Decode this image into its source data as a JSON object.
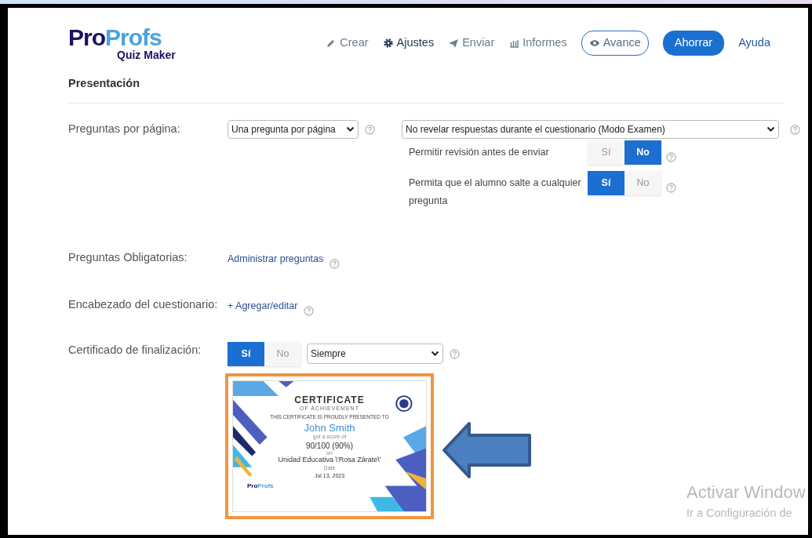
{
  "header": {
    "logo": {
      "part_1": "Pro",
      "part_2": "Profs",
      "subtitle": "Quiz Maker"
    },
    "nav": [
      {
        "label": "Crear",
        "kind": "link",
        "selected": false
      },
      {
        "label": "Ajustes",
        "kind": "link",
        "selected": true
      },
      {
        "label": "Enviar",
        "kind": "link",
        "selected": false
      },
      {
        "label": "Informes",
        "kind": "link",
        "selected": false
      },
      {
        "label": "Avance",
        "kind": "outline"
      },
      {
        "label": "Ahorrar",
        "kind": "primary"
      },
      {
        "label": "Ayuda",
        "kind": "plain"
      }
    ]
  },
  "section_title": "Presentación",
  "questions_per_page": {
    "label": "Preguntas por página:",
    "select": "Una pregunta por página",
    "answers_select": "No revelar respuestas durante el cuestionario (Modo Examen)",
    "options": [
      {
        "label": "Permitir revisión antes de enviar",
        "yes": "Sí",
        "no": "No",
        "on": false
      },
      {
        "label": "Permita que el alumno salte a cualquier pregunta",
        "yes": "Sí",
        "no": "No",
        "on": true
      }
    ]
  },
  "mandatory": {
    "label": "Preguntas Obligatorias:",
    "link": "Administrar preguntas"
  },
  "header_setting": {
    "label": "Encabezado del cuestionario:",
    "link": "+ Agregar/editar"
  },
  "certificate": {
    "label": "Certificado de finalización:",
    "yes": "Sí",
    "no": "No",
    "on": true,
    "select": "Siempre",
    "preview": {
      "title": "CERTIFICATE",
      "subtitle": "OF ACHIEVEMENT",
      "presented": "THIS CERTIFICATE IS PROUDLY PRESENTED TO",
      "name": "John Smith",
      "score_label": "got a score of",
      "score": "90/100 (90%)",
      "on_label": "on",
      "quiz": "Unidad Educativa \\'Rosa Zárate\\'",
      "date_label": "Date",
      "date": "Jul 13, 2023",
      "logo_1": "Pro",
      "logo_2": "Profs"
    }
  },
  "os_notice": {
    "title": "Activar Window",
    "subtitle": "Ir a Configuración de"
  }
}
